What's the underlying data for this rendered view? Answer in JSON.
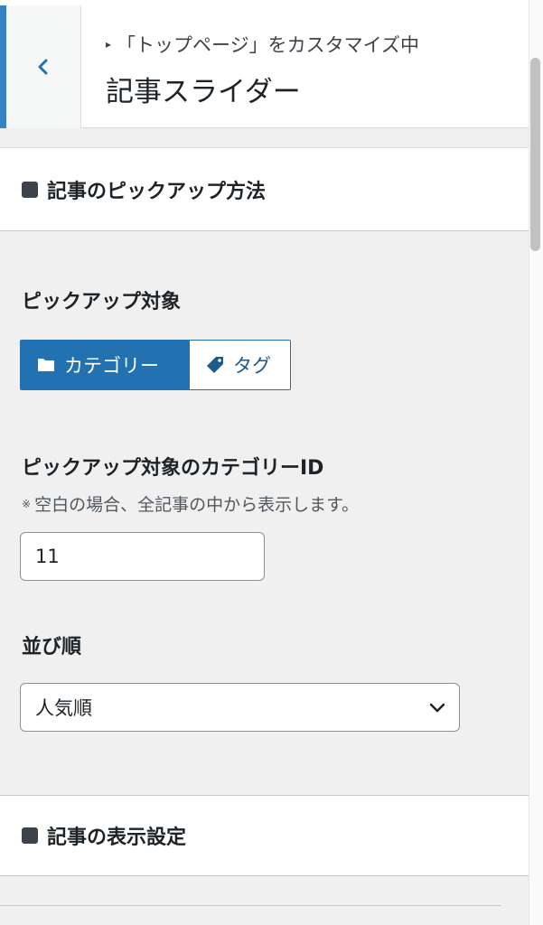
{
  "header": {
    "breadcrumb": "「トップページ」をカスタマイズ中",
    "title": "記事スライダー"
  },
  "sections": {
    "pickup_method": "記事のピックアップ方法",
    "display_settings": "記事の表示設定"
  },
  "pickup_target": {
    "label": "ピックアップ対象",
    "options": [
      {
        "label": "カテゴリー",
        "icon": "folder-icon",
        "selected": true
      },
      {
        "label": "タグ",
        "icon": "tag-icon",
        "selected": false
      }
    ]
  },
  "category_id": {
    "label": "ピックアップ対象のカテゴリーID",
    "note": "空白の場合、全記事の中から表示します。",
    "note_mark": "※",
    "value": "11"
  },
  "order": {
    "label": "並び順",
    "selected": "人気順"
  },
  "colors": {
    "accent": "#2271b1",
    "back_border": "#3582c4"
  }
}
